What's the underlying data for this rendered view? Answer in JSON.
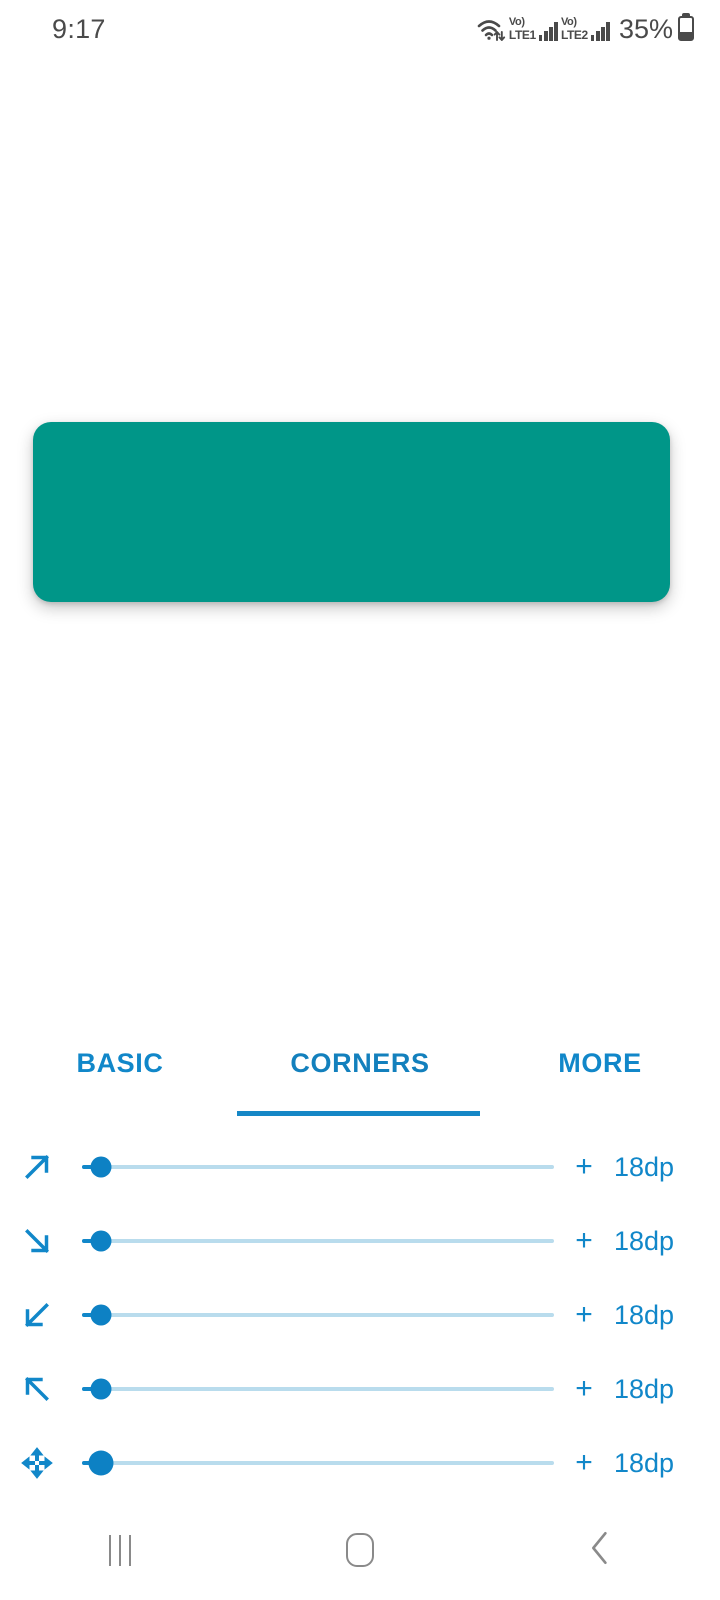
{
  "status_bar": {
    "clock": "9:17",
    "wifi_icon": "wifi-icon",
    "sim1": {
      "vo_label": "Vo)",
      "lte_label": "LTE1"
    },
    "sim2": {
      "vo_label": "Vo)",
      "lte_label": "LTE2"
    },
    "battery_percent": "35%"
  },
  "preview": {
    "shape_name": "shape-preview",
    "shape_color": "#009688",
    "corner_radius_dp": 18
  },
  "tabs": {
    "items": [
      {
        "label": "BASIC",
        "active": false
      },
      {
        "label": "CORNERS",
        "active": true
      },
      {
        "label": "MORE",
        "active": false
      }
    ],
    "accent_color": "#1187c9"
  },
  "sliders": {
    "rows": [
      {
        "icon": "arrow-up-right-icon",
        "value": "18dp",
        "plus": "+",
        "fill_pct": 4
      },
      {
        "icon": "arrow-down-right-icon",
        "value": "18dp",
        "plus": "+",
        "fill_pct": 4
      },
      {
        "icon": "arrow-down-left-icon",
        "value": "18dp",
        "plus": "+",
        "fill_pct": 4
      },
      {
        "icon": "arrow-up-left-icon",
        "value": "18dp",
        "plus": "+",
        "fill_pct": 4
      },
      {
        "icon": "move-all-directions-icon",
        "value": "18dp",
        "plus": "+",
        "fill_pct": 4
      }
    ]
  },
  "nav_bar": {
    "recents_label": "recents-icon",
    "home_label": "home-icon",
    "back_label": "back-icon"
  }
}
